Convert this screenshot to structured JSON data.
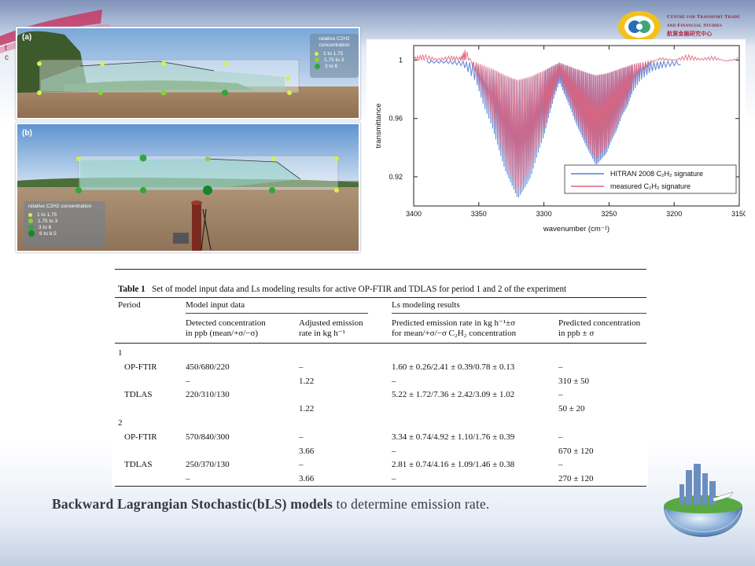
{
  "header": {
    "logo_lines": [
      "Centre for Transport Trade",
      "and Financial Studies"
    ],
    "logo_chinese": "航貿金融研究中心",
    "side_letters": [
      "t",
      "c"
    ]
  },
  "photos": {
    "a": {
      "tag": "(a)",
      "legend_title": "relative C2H2 concentration",
      "legend_rows": [
        {
          "label": "1  to  1.75",
          "color": "#d7f04a"
        },
        {
          "label": "1.75  to  3",
          "color": "#86d23a"
        },
        {
          "label": "3  to  6",
          "color": "#2fa83a"
        }
      ]
    },
    "b": {
      "tag": "(b)",
      "legend_title": "relative C2H2 concentration",
      "legend_rows": [
        {
          "label": "1  to  1.75",
          "color": "#d7f04a"
        },
        {
          "label": "1.75  to  3",
          "color": "#86d23a"
        },
        {
          "label": "3  to  6",
          "color": "#2fa83a"
        },
        {
          "label": "6  to  8.5",
          "color": "#17852b"
        }
      ]
    }
  },
  "chart_data": {
    "type": "line",
    "xlabel": "wavenumber (cm⁻¹)",
    "ylabel": "transmittance",
    "xlim": [
      3400,
      3150
    ],
    "ylim": [
      0.9,
      1.01
    ],
    "x_ticks": [
      3400,
      3350,
      3300,
      3250,
      3200,
      3150
    ],
    "y_ticks": [
      0.92,
      0.96,
      1
    ],
    "x_tick_labels": [
      "3400",
      "3350",
      "3300",
      "3250",
      "3200",
      "3150"
    ],
    "y_tick_labels": [
      "0.92",
      "0.96",
      "1"
    ],
    "legend_position": "bottom-right",
    "series": [
      {
        "name": "HITRAN 2008 C₂H₂ signature",
        "color": "#5b7fd4",
        "x": [
          3390,
          3375,
          3362,
          3352,
          3346,
          3340,
          3335,
          3330,
          3325,
          3320,
          3315,
          3310,
          3305,
          3300,
          3296,
          3292,
          3288,
          3284,
          3280,
          3276,
          3272,
          3268,
          3264,
          3260,
          3256,
          3252,
          3248,
          3244,
          3240,
          3236,
          3232,
          3226,
          3218,
          3208,
          3195
        ],
        "y": [
          0.998,
          0.998,
          0.996,
          0.985,
          0.968,
          0.955,
          0.94,
          0.925,
          0.915,
          0.905,
          0.912,
          0.92,
          0.935,
          0.948,
          0.962,
          0.975,
          0.985,
          0.976,
          0.968,
          0.958,
          0.95,
          0.942,
          0.935,
          0.928,
          0.932,
          0.936,
          0.945,
          0.952,
          0.962,
          0.968,
          0.978,
          0.986,
          0.992,
          0.995,
          0.997
        ]
      },
      {
        "name": "measured C₂H₂ signature",
        "color": "#e0607a",
        "x": [
          3400,
          3392,
          3382,
          3372,
          3364,
          3360,
          3352,
          3346,
          3340,
          3335,
          3330,
          3325,
          3320,
          3315,
          3310,
          3305,
          3300,
          3296,
          3292,
          3288,
          3284,
          3280,
          3276,
          3272,
          3268,
          3264,
          3260,
          3256,
          3252,
          3248,
          3244,
          3240,
          3236,
          3232,
          3226,
          3218,
          3210,
          3200,
          3190,
          3180,
          3170,
          3160,
          3150
        ],
        "y": [
          1.002,
          1.004,
          1.001,
          1.003,
          1.002,
          1.008,
          0.99,
          0.976,
          0.962,
          0.948,
          0.932,
          0.92,
          0.91,
          0.918,
          0.926,
          0.94,
          0.952,
          0.966,
          0.978,
          0.99,
          0.98,
          0.972,
          0.962,
          0.955,
          0.946,
          0.938,
          0.932,
          0.936,
          0.94,
          0.948,
          0.956,
          0.965,
          0.972,
          0.982,
          0.99,
          0.998,
          1.002,
          1.0,
          1.004,
          1.001,
          1.003,
          0.999,
          1.002
        ]
      }
    ]
  },
  "table": {
    "caption_bold": "Table 1",
    "caption_text": "Set of model input data and Ls modeling results for active OP-FTIR and TDLAS for period 1 and 2 of the experiment",
    "headers": {
      "period": "Period",
      "model_input": "Model input data",
      "ls_results": "Ls modeling results",
      "detected_line1": "Detected concentration",
      "detected_line2": "in ppb (mean/+σ/−σ)",
      "adjusted_line1": "Adjusted emission",
      "adjusted_line2": "rate in kg h⁻¹",
      "predicted_rate_line1": "Predicted emission rate in kg h⁻¹±σ",
      "predicted_rate_line2": "for mean/+σ/−σ C₂H₂ concentration",
      "predicted_conc_line1": "Predicted concentration",
      "predicted_conc_line2": "in ppb ± σ"
    },
    "rows": [
      {
        "period": "1",
        "instrument": "",
        "detected": "",
        "adjusted": "",
        "pred_rate": "",
        "pred_conc": ""
      },
      {
        "period": "",
        "instrument": "OP-FTIR",
        "detected": "450/680/220",
        "adjusted": "–",
        "pred_rate": "1.60 ± 0.26/2.41 ± 0.39/0.78 ± 0.13",
        "pred_conc": "–"
      },
      {
        "period": "",
        "instrument": "",
        "detected": "–",
        "adjusted": "1.22",
        "pred_rate": "–",
        "pred_conc": "310 ± 50"
      },
      {
        "period": "",
        "instrument": "TDLAS",
        "detected": "220/310/130",
        "adjusted": "",
        "pred_rate": "5.22 ± 1.72/7.36 ± 2.42/3.09 ± 1.02",
        "pred_conc": "–"
      },
      {
        "period": "",
        "instrument": "",
        "detected": "",
        "adjusted": "1.22",
        "pred_rate": "",
        "pred_conc": "50 ± 20"
      },
      {
        "period": "2",
        "instrument": "",
        "detected": "",
        "adjusted": "",
        "pred_rate": "",
        "pred_conc": ""
      },
      {
        "period": "",
        "instrument": "OP-FTIR",
        "detected": "570/840/300",
        "adjusted": "–",
        "pred_rate": "3.34 ± 0.74/4.92 ± 1.10/1.76 ± 0.39",
        "pred_conc": "–"
      },
      {
        "period": "",
        "instrument": "",
        "detected": "",
        "adjusted": "3.66",
        "pred_rate": "–",
        "pred_conc": "670 ± 120"
      },
      {
        "period": "",
        "instrument": "TDLAS",
        "detected": "250/370/130",
        "adjusted": "–",
        "pred_rate": "2.81 ± 0.74/4.16 ± 1.09/1.46 ± 0.38",
        "pred_conc": "–"
      },
      {
        "period": "",
        "instrument": "",
        "detected": "–",
        "adjusted": "3.66",
        "pred_rate": "–",
        "pred_conc": "270 ± 120"
      }
    ]
  },
  "caption": {
    "bold_part": "Backward Lagrangian Stochastic(bLS) models",
    "rest": " to determine emission rate."
  },
  "colors": {
    "brand_maroon": "#8a1f3c",
    "legend_dot_light": "#d7f04a",
    "legend_dot_mid": "#86d23a",
    "legend_dot_dark": "#2fa83a",
    "legend_dot_darkest": "#17852b"
  },
  "icons": [
    "logo-mark-icon",
    "globe-city-icon",
    "accent-ribbon-icon"
  ]
}
